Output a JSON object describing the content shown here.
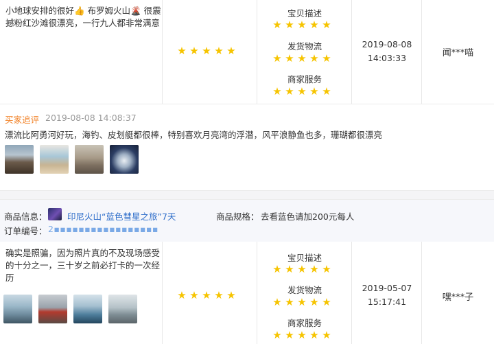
{
  "review1": {
    "text": "小地球安排的很好👍 布罗姆火山🌋 很震撼粉红沙滩很漂亮，一行九人都非常满意",
    "overall_rating": 5,
    "dimensions": [
      {
        "label": "宝贝描述",
        "rating": 5
      },
      {
        "label": "发货物流",
        "rating": 5
      },
      {
        "label": "商家服务",
        "rating": 5
      }
    ],
    "date": "2019-08-08",
    "time": "14:03:33",
    "user": "闻***喵"
  },
  "followup": {
    "label": "买家追评",
    "timestamp": "2019-08-08 14:08:37",
    "text": "漂流比阿勇河好玩，海钓、皮划艇都很棒，特别喜欢月亮湾的浮潜，风平浪静鱼也多，珊瑚都很漂亮",
    "photos": [
      "volcano-photo",
      "beach-photo",
      "mountain-photo",
      "fish-photo"
    ]
  },
  "order": {
    "product_label": "商品信息：",
    "product_name": "印尼火山“蓝色彗星之旅”7天",
    "spec_label": "商品规格：",
    "spec_value": "去看蓝色请加200元每人",
    "order_no_label": "订单编号：",
    "order_no_value": "2▪▪▪▪▪▪▪▪▪▪▪▪▪▪▪▪▪"
  },
  "review2": {
    "text": "确实是照骗，因为照片真的不及现场感受的十分之一，三十岁之前必打卡的一次经历",
    "overall_rating": 5,
    "dimensions": [
      {
        "label": "宝贝描述",
        "rating": 5
      },
      {
        "label": "发货物流",
        "rating": 5
      },
      {
        "label": "商家服务",
        "rating": 5
      }
    ],
    "date": "2019-05-07",
    "time": "15:17:41",
    "user": "嘿***子",
    "photos": [
      "seaside-photo",
      "car-photo",
      "sea-spray-photo",
      "shore-photo"
    ]
  },
  "colors": {
    "star": "#f6c400",
    "followup_label": "#f2842b",
    "link": "#2a6bc9"
  }
}
